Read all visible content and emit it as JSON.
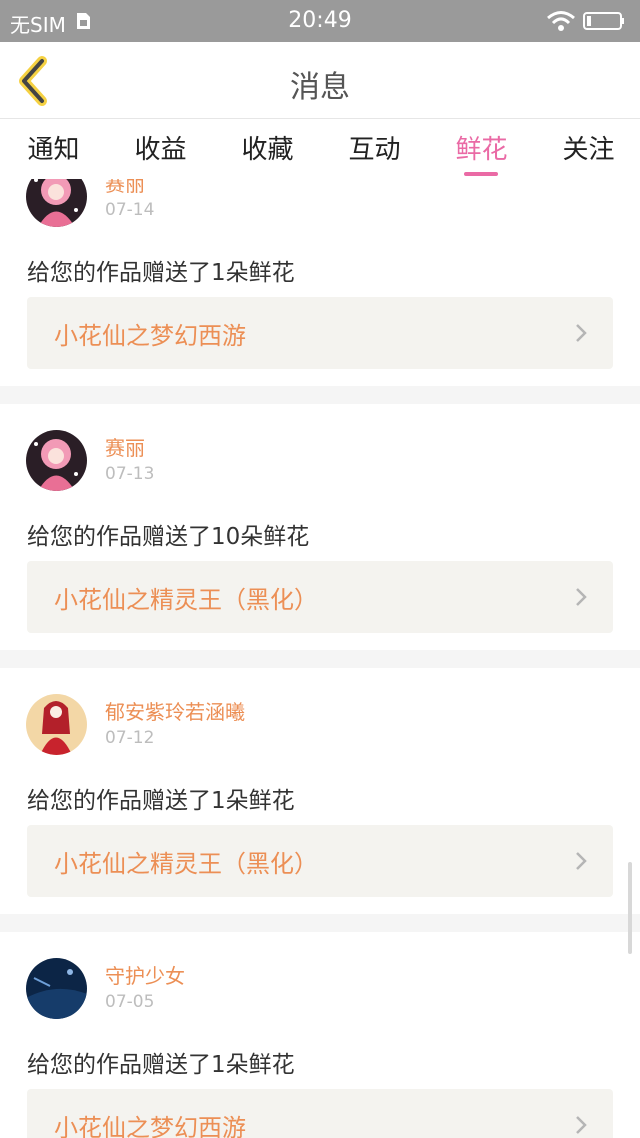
{
  "status_bar": {
    "carrier": "无SIM",
    "time": "20:49"
  },
  "header": {
    "title": "消息",
    "back_icon": "chevron-left-icon"
  },
  "tabs": [
    {
      "label": "通知",
      "active": false
    },
    {
      "label": "收益",
      "active": false
    },
    {
      "label": "收藏",
      "active": false
    },
    {
      "label": "互动",
      "active": false
    },
    {
      "label": "鲜花",
      "active": true
    },
    {
      "label": "关注",
      "active": false
    }
  ],
  "colors": {
    "accent": "#ea6aa5",
    "username": "#ec8f55",
    "work_title": "#ec8f55",
    "date": "#bdbdbd",
    "link_bg": "#f4f3ef"
  },
  "messages": [
    {
      "user": "赛丽",
      "date": "07-14",
      "text": "给您的作品赠送了1朵鲜花",
      "work": "小花仙之梦幻西游",
      "avatar": "pink-hair-avatar"
    },
    {
      "user": "赛丽",
      "date": "07-13",
      "text": "给您的作品赠送了10朵鲜花",
      "work": "小花仙之精灵王（黑化）",
      "avatar": "pink-hair-avatar"
    },
    {
      "user": "郁安紫玲若涵曦",
      "date": "07-12",
      "text": "给您的作品赠送了1朵鲜花",
      "work": "小花仙之精灵王（黑化）",
      "avatar": "red-dress-avatar"
    },
    {
      "user": "守护少女",
      "date": "07-05",
      "text": "给您的作品赠送了1朵鲜花",
      "work": "小花仙之梦幻西游",
      "avatar": "blue-night-avatar"
    }
  ]
}
